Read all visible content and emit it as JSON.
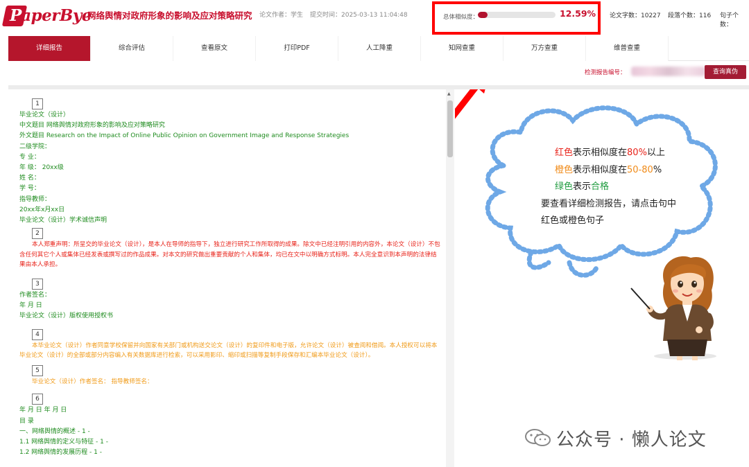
{
  "header": {
    "logo_text": "PaperBye",
    "title": "网络舆情对政府形象的影响及应对策略研究",
    "author_label": "论文作者：学生",
    "submit_label": "提交时间：2025-03-13 11:04:48",
    "similarity_label": "总体相似度：",
    "similarity_value": "12.59%",
    "similarity_fraction": 0.1259,
    "word_count": "论文字数：10227",
    "paragraph_count": "段落个数：116",
    "sentence_count": "句子个数："
  },
  "tabs": [
    "详细报告",
    "综合评估",
    "查看原文",
    "打印PDF",
    "人工降重",
    "知网查重",
    "万方查重",
    "维普查重"
  ],
  "subbar": {
    "report_no_label": "检测报告编号：",
    "query_button": "查询真伪"
  },
  "doc": {
    "p1_num": "1",
    "p1_lines": [
      "毕业论文（设计）",
      "中文题目 网络舆情对政府形象的影响及应对策略研究",
      "外文题目 Research on the Impact of Online Public Opinion on Government Image and Response Strategies",
      "二级学院：",
      "专 业：",
      "年 级： 20xx级",
      "姓 名：",
      "学 号：",
      "指导教师：",
      "20xx年x月xx日",
      "毕业论文（设计）学术诚信声明"
    ],
    "p2_num": "2",
    "p2_text": "本人郑重声明：所呈交的毕业论文（设计），是本人在导师的指导下，独立进行研究工作所取得的成果。除文中已经注明引用的内容外，本论文（设计）不包含任何其它个人或集体已经发表或撰写过的作品成果。对本文的研究做出重要贡献的个人和集体，均已在文中以明确方式标明。本人完全意识到本声明的法律结果由本人承担。",
    "p3_num": "3",
    "p3_lines": [
      "作者签名：",
      "年 月 日",
      "毕业论文（设计）版权使用授权书"
    ],
    "p4_num": "4",
    "p4_text": "本毕业论文（设计）作者同意学校保留并向国家有关部门或机构送交论文（设计）的复印件和电子版，允许论文（设计）被查阅和借阅。本人授权可以将本毕业论文（设计）的全部或部分内容编入有关数据库进行检索，可以采用影印、缩印或扫描等复制手段保存和汇编本毕业论文（设计）。",
    "p5_num": "5",
    "p5_text": "毕业论文（设计）作者签名： 指导教师签名：",
    "p6_num": "6",
    "p6_lines": [
      "年 月 日 年 月 日",
      "目 录",
      "一、网络舆情的概述 - 1 -",
      "1.1 网络舆情的定义与特征 - 1 -",
      "1.2 网络舆情的发展历程 - 1 -"
    ]
  },
  "legend": {
    "red_word": "红色",
    "red_mid": "表示相似度在",
    "red_pct": "80%",
    "red_tail": "以上",
    "orange_word": "橙色",
    "orange_mid": "表示相似度在",
    "orange_pct": "50-80",
    "orange_tail": "%",
    "green_word": "绿色",
    "green_mid": "表示",
    "green_tail": "合格",
    "hint1": "要查看详细检测报告，请点击句中",
    "hint2": "红色或橙色句子"
  },
  "watermark": "公众号 · 懒人论文",
  "colors": {
    "brand": "#c8102e",
    "tab_active": "#b5162c",
    "red_text": "#e8231a",
    "orange_text": "#f09a17",
    "green_text": "#1e8b1e",
    "highlight_box": "#ff0000",
    "cloud": "#6ea8e6"
  },
  "icons": {
    "arrow": "red-arrow-icon",
    "cloud": "thought-cloud-icon",
    "mascot": "teacher-mascot-icon",
    "wechat": "wechat-icon"
  }
}
